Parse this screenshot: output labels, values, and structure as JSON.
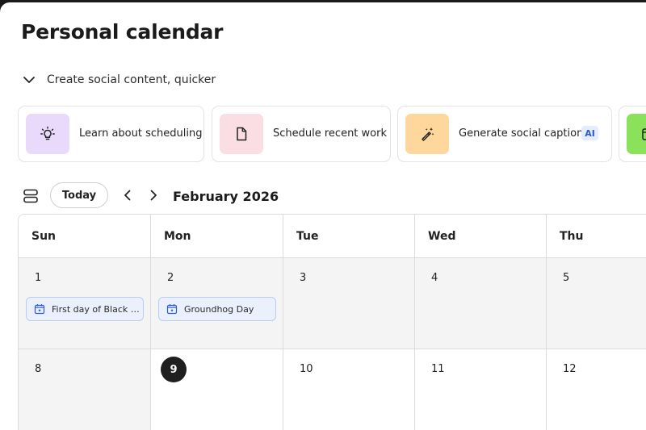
{
  "page": {
    "title": "Personal calendar"
  },
  "promo": {
    "section_label": "Create social content, quicker",
    "cards": [
      {
        "label": "Learn about scheduling",
        "icon": "lightbulb-icon",
        "color": "#e9dafb"
      },
      {
        "label": "Schedule recent work",
        "icon": "document-icon",
        "color": "#fbdde4"
      },
      {
        "label": "Generate social captions",
        "icon": "magic-brush-icon",
        "color": "#fdd79c",
        "badge": "AI"
      },
      {
        "label": "",
        "icon": "calendar-icon",
        "color": "#8ae25a"
      }
    ]
  },
  "toolbar": {
    "today_label": "Today",
    "month_label": "February 2026"
  },
  "calendar": {
    "weekdays": [
      "Sun",
      "Mon",
      "Tue",
      "Wed",
      "Thu"
    ],
    "weeks": [
      [
        {
          "day": "1",
          "event": "First day of Black History Month"
        },
        {
          "day": "2",
          "event": "Groundhog Day"
        },
        {
          "day": "3"
        },
        {
          "day": "4"
        },
        {
          "day": "5"
        }
      ],
      [
        {
          "day": "8"
        },
        {
          "day": "9",
          "today": true
        },
        {
          "day": "10"
        },
        {
          "day": "11"
        },
        {
          "day": "12"
        }
      ]
    ]
  },
  "colors": {
    "event_bg": "#eaf0fc",
    "event_border": "#b9cdf4",
    "event_icon": "#2d5bd3",
    "today_circle": "#1f1f1f",
    "ai_badge_text": "#2d5bd3"
  }
}
